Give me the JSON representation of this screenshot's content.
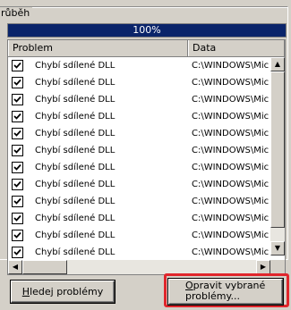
{
  "group": {
    "title": "růběh"
  },
  "progress": {
    "percent": 100,
    "label": "100%"
  },
  "list": {
    "columns": [
      "Problem",
      "Data"
    ],
    "rows": [
      {
        "checked": true,
        "problem": "Chybí sdílené DLL",
        "data": "C:\\WINDOWS\\Mic"
      },
      {
        "checked": true,
        "problem": "Chybí sdílené DLL",
        "data": "C:\\WINDOWS\\Mic"
      },
      {
        "checked": true,
        "problem": "Chybí sdílené DLL",
        "data": "C:\\WINDOWS\\Mic"
      },
      {
        "checked": true,
        "problem": "Chybí sdílené DLL",
        "data": "C:\\WINDOWS\\Mic"
      },
      {
        "checked": true,
        "problem": "Chybí sdílené DLL",
        "data": "C:\\WINDOWS\\Mic"
      },
      {
        "checked": true,
        "problem": "Chybí sdílené DLL",
        "data": "C:\\WINDOWS\\Mic"
      },
      {
        "checked": true,
        "problem": "Chybí sdílené DLL",
        "data": "C:\\WINDOWS\\Mic"
      },
      {
        "checked": true,
        "problem": "Chybí sdílené DLL",
        "data": "C:\\WINDOWS\\Mic"
      },
      {
        "checked": true,
        "problem": "Chybí sdílené DLL",
        "data": "C:\\WINDOWS\\Mic"
      },
      {
        "checked": true,
        "problem": "Chybí sdílené DLL",
        "data": "C:\\WINDOWS\\Mic"
      },
      {
        "checked": true,
        "problem": "Chybí sdílené DLL",
        "data": "C:\\WINDOWS\\Mic"
      },
      {
        "checked": true,
        "problem": "Chybí sdílené DLL",
        "data": "C:\\WINDOWS\\Mic"
      }
    ]
  },
  "buttons": {
    "find_accel": "H",
    "find_rest": "ledej problémy",
    "fix_accel": "O",
    "fix_line1_rest": "pravit vybrané",
    "fix_line2": "problémy..."
  },
  "colors": {
    "progress": "#0a246a",
    "highlight": "#e0262c"
  }
}
